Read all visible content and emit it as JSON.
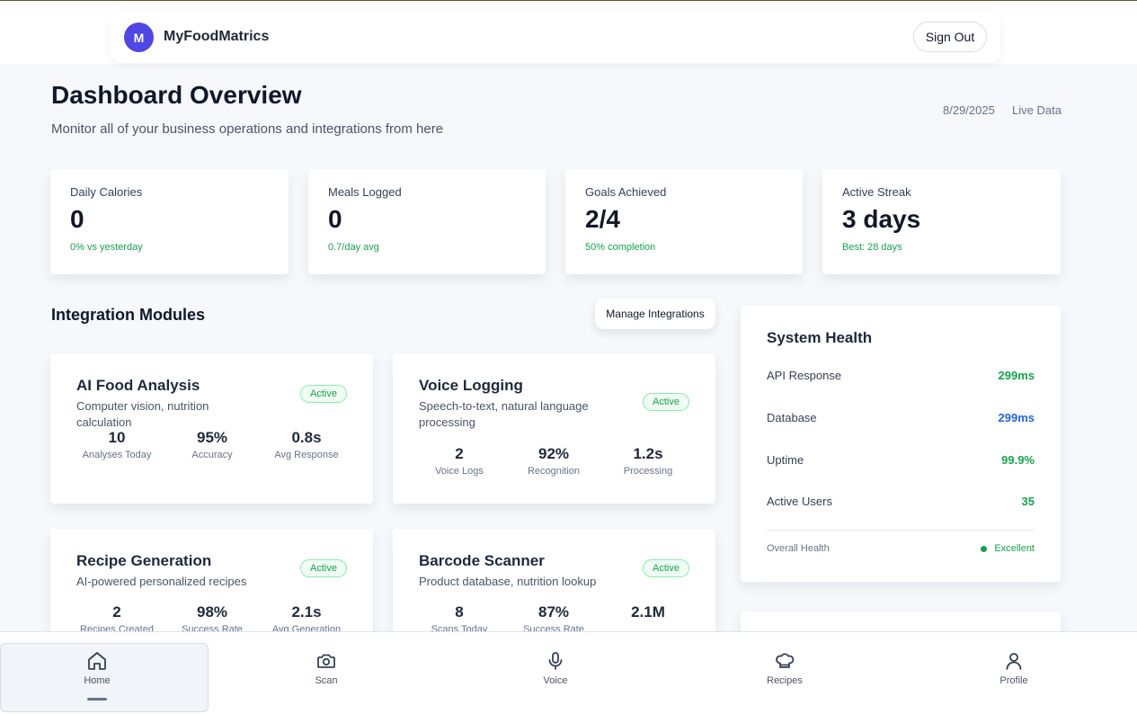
{
  "header": {
    "avatar_letter": "M",
    "brand": "MyFoodMatrics",
    "sign_out": "Sign Out"
  },
  "page": {
    "title": "Dashboard Overview",
    "subtitle": "Monitor all of your business operations and integrations from here",
    "date": "8/29/2025",
    "live": "Live Data"
  },
  "stats": [
    {
      "label": "Daily Calories",
      "value": "0",
      "note": "0% vs yesterday"
    },
    {
      "label": "Meals Logged",
      "value": "0",
      "note": "0.7/day avg"
    },
    {
      "label": "Goals Achieved",
      "value": "2/4",
      "note": "50% completion"
    },
    {
      "label": "Active Streak",
      "value": "3 days",
      "note": "Best: 28 days"
    }
  ],
  "integrations": {
    "title": "Integration Modules",
    "manage": "Manage Integrations",
    "modules": [
      {
        "title": "AI Food Analysis",
        "desc": "Computer vision, nutrition calculation",
        "status": "Active",
        "metrics": [
          {
            "value": "10",
            "label": "Analyses Today"
          },
          {
            "value": "95%",
            "label": "Accuracy"
          },
          {
            "value": "0.8s",
            "label": "Avg Response"
          }
        ]
      },
      {
        "title": "Voice Logging",
        "desc": "Speech-to-text, natural language processing",
        "status": "Active",
        "metrics": [
          {
            "value": "2",
            "label": "Voice Logs"
          },
          {
            "value": "92%",
            "label": "Recognition"
          },
          {
            "value": "1.2s",
            "label": "Processing"
          }
        ]
      },
      {
        "title": "Recipe Generation",
        "desc": "AI-powered personalized recipes",
        "status": "Active",
        "metrics": [
          {
            "value": "2",
            "label": "Recipes Created"
          },
          {
            "value": "98%",
            "label": "Success Rate"
          },
          {
            "value": "2.1s",
            "label": "Avg Generation"
          }
        ]
      },
      {
        "title": "Barcode Scanner",
        "desc": "Product database, nutrition lookup",
        "status": "Active",
        "metrics": [
          {
            "value": "8",
            "label": "Scans Today"
          },
          {
            "value": "87%",
            "label": "Success Rate"
          },
          {
            "value": "2.1M",
            "label": ""
          }
        ]
      }
    ]
  },
  "health": {
    "title": "System Health",
    "rows": [
      {
        "label": "API Response",
        "value": "299ms",
        "color": "#16a34a"
      },
      {
        "label": "Database",
        "value": "299ms",
        "color": "#2563eb"
      },
      {
        "label": "Uptime",
        "value": "99.9%",
        "color": "#16a34a"
      },
      {
        "label": "Active Users",
        "value": "35",
        "color": "#16a34a"
      }
    ],
    "overall_label": "Overall Health",
    "overall_value": "Excellent"
  },
  "nav": [
    {
      "label": "Home",
      "icon": "home-icon",
      "active": true
    },
    {
      "label": "Scan",
      "icon": "camera-icon"
    },
    {
      "label": "Voice",
      "icon": "microphone-icon"
    },
    {
      "label": "Recipes",
      "icon": "chef-hat-icon"
    },
    {
      "label": "Profile",
      "icon": "user-icon"
    }
  ]
}
